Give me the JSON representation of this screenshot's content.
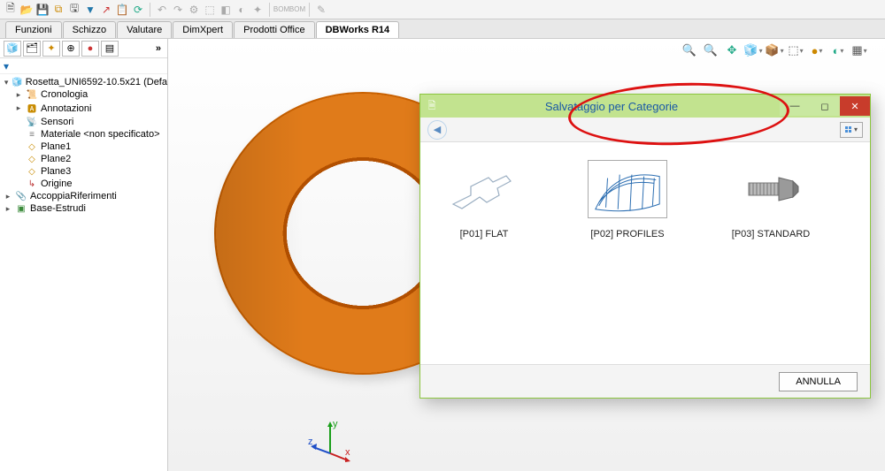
{
  "toolbar": {
    "icons": [
      "new",
      "open",
      "save",
      "bookmark",
      "save-all",
      "filter",
      "export",
      "paste",
      "refresh",
      "sep",
      "undo",
      "redo",
      "rebuild",
      "sep",
      "analyze",
      "render",
      "shade",
      "settings",
      "sep",
      "bom1",
      "bom2",
      "sep",
      "sketch-tool",
      "sep"
    ]
  },
  "tabs": [
    {
      "id": "funzioni",
      "label": "Funzioni",
      "active": false
    },
    {
      "id": "schizzo",
      "label": "Schizzo",
      "active": false
    },
    {
      "id": "valutare",
      "label": "Valutare",
      "active": false
    },
    {
      "id": "dimxpert",
      "label": "DimXpert",
      "active": false
    },
    {
      "id": "prodotti",
      "label": "Prodotti Office",
      "active": false
    },
    {
      "id": "dbworks",
      "label": "DBWorks R14",
      "active": true
    }
  ],
  "featuretree": {
    "root": "Rosetta_UNI6592-10.5x21 (Defa",
    "items": [
      {
        "icon": "📜",
        "label": "Cronologia",
        "expand": true,
        "indent": 1
      },
      {
        "icon": "🅰",
        "label": "Annotazioni",
        "expand": true,
        "indent": 1,
        "color": "#c88b00"
      },
      {
        "icon": "📡",
        "label": "Sensori",
        "expand": false,
        "indent": 1,
        "color": "#2a8"
      },
      {
        "icon": "≡",
        "label": "Materiale <non specificato>",
        "expand": false,
        "indent": 1,
        "color": "#777"
      },
      {
        "icon": "◇",
        "label": "Plane1",
        "expand": false,
        "indent": 1,
        "color": "#c88b00"
      },
      {
        "icon": "◇",
        "label": "Plane2",
        "expand": false,
        "indent": 1,
        "color": "#c88b00"
      },
      {
        "icon": "◇",
        "label": "Plane3",
        "expand": false,
        "indent": 1,
        "color": "#c88b00"
      },
      {
        "icon": "↳",
        "label": "Origine",
        "expand": false,
        "indent": 1,
        "color": "#b33"
      },
      {
        "icon": "📎",
        "label": "AccoppiaRiferimenti",
        "expand": true,
        "indent": 0,
        "root": true,
        "color": "#2a8"
      },
      {
        "icon": "▣",
        "label": "Base-Estrudi",
        "expand": true,
        "indent": 0,
        "root": true,
        "color": "#3a8a3a"
      }
    ]
  },
  "viewribbon": [
    "zoom-in",
    "zoom-out",
    "pan",
    "box",
    "sep",
    "display",
    "sep",
    "shade",
    "sep",
    "hidden",
    "sep",
    "appearance",
    "sep",
    "light",
    "sep"
  ],
  "triad": {
    "x": "x",
    "y": "y",
    "z": "z"
  },
  "dialog": {
    "title": "Salvataggio per Categorie",
    "back": "back",
    "categories": [
      {
        "id": "p01",
        "label": "[P01] FLAT"
      },
      {
        "id": "p02",
        "label": "[P02] PROFILES"
      },
      {
        "id": "p03",
        "label": "[P03] STANDARD"
      }
    ],
    "cancel": "ANNULLA"
  }
}
